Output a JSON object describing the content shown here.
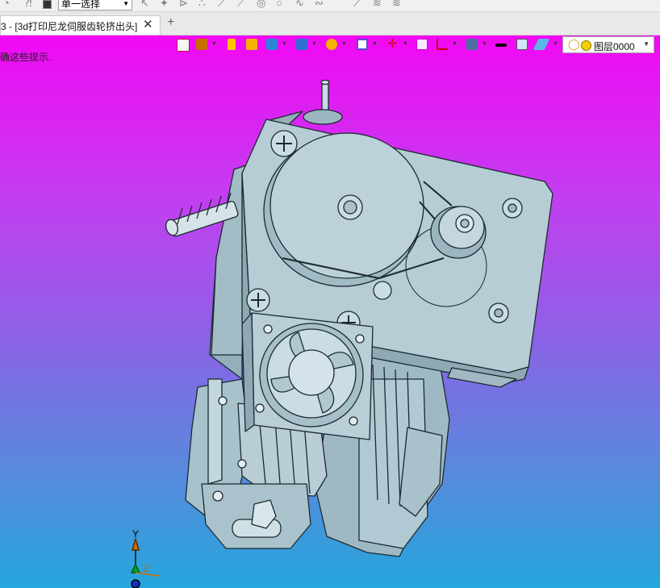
{
  "toolbar": {
    "selection_filter": "单一选择"
  },
  "tab": {
    "title": "3 - [3d打印尼龙伺服齿轮挤出头]"
  },
  "viewport": {
    "hint": "确这些提示.",
    "layer": "图层0000",
    "colors": {
      "gradient_top": "#f208f4",
      "gradient_bottom": "#25a6dc",
      "model_face": "#b6cdd6",
      "model_edge": "#1c2a30"
    },
    "axis": {
      "y": "Y",
      "z": "Z"
    }
  }
}
